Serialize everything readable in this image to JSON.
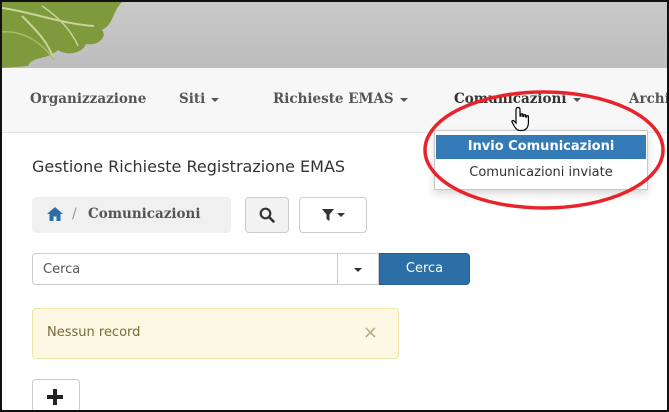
{
  "navbar": {
    "items": [
      {
        "label": "Organizzazione",
        "has_caret": false
      },
      {
        "label": "Siti",
        "has_caret": true
      },
      {
        "label": "Richieste EMAS",
        "has_caret": true
      },
      {
        "label": "Comunicazioni",
        "has_caret": true,
        "active": true
      },
      {
        "label": "Archi",
        "has_caret": false
      }
    ]
  },
  "dropdown": {
    "items": [
      {
        "label": "Invio Comunicazioni",
        "selected": true
      },
      {
        "label": "Comunicazioni inviate",
        "selected": false
      }
    ]
  },
  "page": {
    "title": "Gestione Richieste Registrazione EMAS"
  },
  "breadcrumb": {
    "label": "Comunicazioni",
    "separator": "/"
  },
  "search": {
    "placeholder": "Cerca",
    "button_label": "Cerca"
  },
  "alert": {
    "message": "Nessun record",
    "close": "×"
  },
  "icons": {
    "home": "home-icon",
    "search": "search-icon",
    "filter": "filter-icon",
    "add": "plus-icon",
    "cursor": "hand-pointer-icon"
  },
  "colors": {
    "primary": "#2c6ea6",
    "menu_selected": "#337ab7",
    "alert_bg": "#fcf8e3",
    "highlight_ring": "#e8242a"
  }
}
